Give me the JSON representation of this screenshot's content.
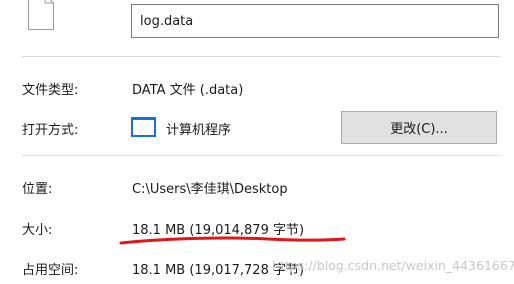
{
  "file": {
    "icon": "file-icon",
    "name_value": "log.data"
  },
  "properties": {
    "type_label": "文件类型:",
    "type_value": "DATA 文件 (.data)",
    "opens_with_label": "打开方式:",
    "opens_with_icon": "program-window-icon",
    "opens_with_value": "计算机程序",
    "change_button_label": "更改(C)...",
    "location_label": "位置:",
    "location_value": "C:\\Users\\李佳琪\\Desktop",
    "size_label": "大小:",
    "size_value": "18.1 MB (19,014,879 字节)",
    "size_on_disk_label": "占用空间:",
    "size_on_disk_value": "18.1 MB (19,017,728 字节)"
  },
  "annotation": {
    "underline_color": "#e0161b"
  },
  "watermark": {
    "text": "https://blog.csdn.net/weixin_44361667"
  },
  "colors": {
    "accent": "#1a6fd0",
    "separator": "#dcdcdc",
    "button_bg": "#e1e1e1"
  }
}
